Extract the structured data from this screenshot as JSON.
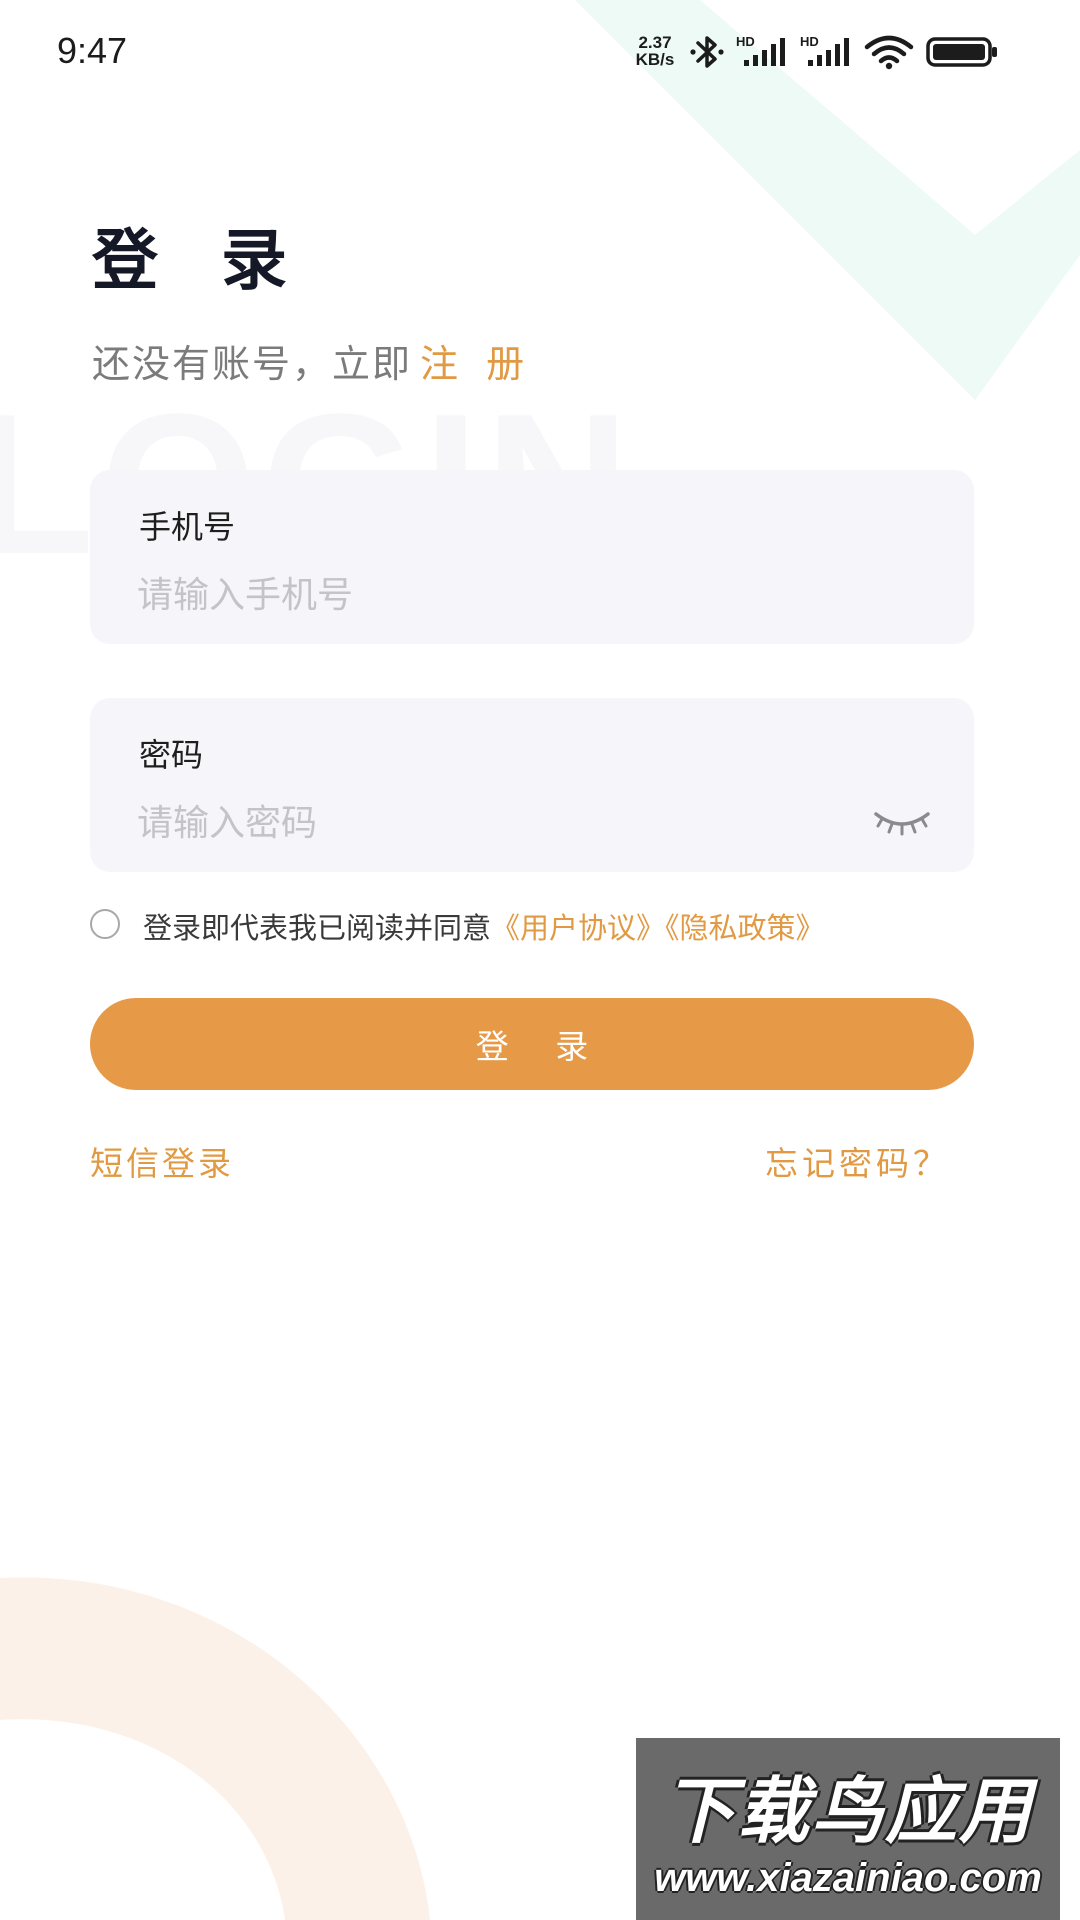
{
  "status_bar": {
    "time": "9:47",
    "net_speed_value": "2.37",
    "net_speed_unit": "KB/s",
    "signal_1_label": "HD",
    "signal_2_label": "HD",
    "icons": [
      "bluetooth-icon",
      "signal-icon",
      "signal-icon",
      "wifi-icon",
      "battery-icon"
    ]
  },
  "background": {
    "watermark_word": "LOGIN"
  },
  "header": {
    "title": "登 录",
    "register_prompt": "还没有账号，立即",
    "register_link": "注 册"
  },
  "form": {
    "phone": {
      "label": "手机号",
      "placeholder": "请输入手机号",
      "value": ""
    },
    "password": {
      "label": "密码",
      "placeholder": "请输入密码",
      "value": "",
      "visibility_icon": "eye-closed-icon"
    }
  },
  "agreement": {
    "checked": false,
    "text": "登录即代表我已阅读并同意",
    "user_agreement": "《用户协议》",
    "privacy_policy": "《隐私政策》"
  },
  "actions": {
    "login_button": "登 录",
    "sms_login": "短信登录",
    "forgot_password": "忘记密码？"
  },
  "watermark": {
    "title": "下载鸟应用",
    "url": "www.xiazainiao.com"
  },
  "colors": {
    "accent": "#e69a48",
    "link": "#e19a43",
    "title": "#151826",
    "field_bg": "#f6f6fa",
    "placeholder": "#c4c4c8",
    "deco_green": "#eefaf5",
    "deco_orange": "#fcf1e8"
  }
}
